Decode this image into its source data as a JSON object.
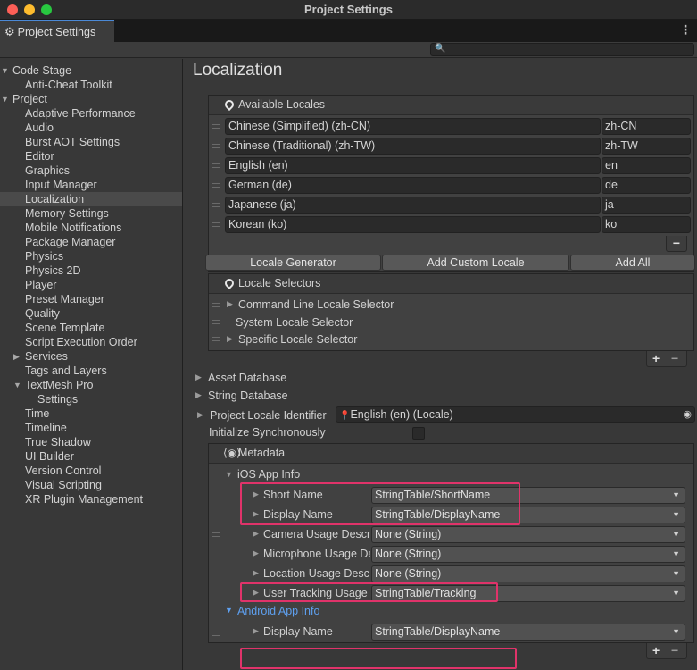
{
  "window": {
    "title": "Project Settings",
    "tab_label": "Project Settings"
  },
  "search": {
    "placeholder": ""
  },
  "sidebar": {
    "items": [
      {
        "label": "Code Stage",
        "indent": 0,
        "arrow": "expanded"
      },
      {
        "label": "Anti-Cheat Toolkit",
        "indent": 2
      },
      {
        "label": "Project",
        "indent": 0,
        "arrow": "expanded"
      },
      {
        "label": "Adaptive Performance",
        "indent": 2
      },
      {
        "label": "Audio",
        "indent": 2
      },
      {
        "label": "Burst AOT Settings",
        "indent": 2
      },
      {
        "label": "Editor",
        "indent": 2
      },
      {
        "label": "Graphics",
        "indent": 2
      },
      {
        "label": "Input Manager",
        "indent": 2
      },
      {
        "label": "Localization",
        "indent": 2,
        "selected": true
      },
      {
        "label": "Memory Settings",
        "indent": 2
      },
      {
        "label": "Mobile Notifications",
        "indent": 2
      },
      {
        "label": "Package Manager",
        "indent": 2
      },
      {
        "label": "Physics",
        "indent": 2
      },
      {
        "label": "Physics 2D",
        "indent": 2
      },
      {
        "label": "Player",
        "indent": 2
      },
      {
        "label": "Preset Manager",
        "indent": 2
      },
      {
        "label": "Quality",
        "indent": 2
      },
      {
        "label": "Scene Template",
        "indent": 2
      },
      {
        "label": "Script Execution Order",
        "indent": 2
      },
      {
        "label": "Services",
        "indent": 2,
        "arrow": "collapsed"
      },
      {
        "label": "Tags and Layers",
        "indent": 2
      },
      {
        "label": "TextMesh Pro",
        "indent": 2,
        "arrow": "expanded"
      },
      {
        "label": "Settings",
        "indent": 3
      },
      {
        "label": "Time",
        "indent": 2
      },
      {
        "label": "Timeline",
        "indent": 2
      },
      {
        "label": "True Shadow",
        "indent": 2
      },
      {
        "label": "UI Builder",
        "indent": 2
      },
      {
        "label": "Version Control",
        "indent": 2
      },
      {
        "label": "Visual Scripting",
        "indent": 2
      },
      {
        "label": "XR Plugin Management",
        "indent": 2
      }
    ]
  },
  "main": {
    "title": "Localization",
    "available_locales": {
      "header": "Available Locales",
      "rows": [
        {
          "name": "Chinese (Simplified) (zh-CN)",
          "code": "zh-CN"
        },
        {
          "name": "Chinese (Traditional) (zh-TW)",
          "code": "zh-TW"
        },
        {
          "name": "English (en)",
          "code": "en"
        },
        {
          "name": "German (de)",
          "code": "de"
        },
        {
          "name": "Japanese (ja)",
          "code": "ja"
        },
        {
          "name": "Korean (ko)",
          "code": "ko"
        }
      ],
      "remove_label": "−"
    },
    "buttons": {
      "generator": "Locale Generator",
      "custom": "Add Custom Locale",
      "add_all": "Add All"
    },
    "locale_selectors": {
      "header": "Locale Selectors",
      "items": [
        "Command Line Locale Selector",
        "System Locale Selector",
        "Specific Locale Selector"
      ],
      "add_label": "+",
      "remove_label": "−"
    },
    "asset_database": "Asset Database",
    "string_database": "String Database",
    "project_locale_identifier": {
      "label": "Project Locale Identifier",
      "value": "English (en) (Locale)"
    },
    "initialize_synchronously": {
      "label": "Initialize Synchronously",
      "checked": false
    },
    "metadata": {
      "header": "Metadata",
      "ios": {
        "label": "iOS App Info",
        "rows": [
          {
            "label": "Short Name",
            "value": "StringTable/ShortName",
            "highlighted": true
          },
          {
            "label": "Display Name",
            "value": "StringTable/DisplayName",
            "highlighted": true
          },
          {
            "label": "Camera Usage Descri",
            "value": "None (String)"
          },
          {
            "label": "Microphone Usage De",
            "value": "None (String)"
          },
          {
            "label": "Location Usage Desc",
            "value": "None (String)"
          },
          {
            "label": "User Tracking Usage",
            "value": "StringTable/Tracking",
            "highlighted": true
          }
        ]
      },
      "android": {
        "label": "Android App Info",
        "rows": [
          {
            "label": "Display Name",
            "value": "StringTable/DisplayName",
            "highlighted": true
          }
        ]
      },
      "add_label": "+",
      "remove_label": "−"
    }
  },
  "colors": {
    "accent_blue": "#4b89d6",
    "highlight": "#e0336a",
    "android_link": "#5ea0f0"
  }
}
